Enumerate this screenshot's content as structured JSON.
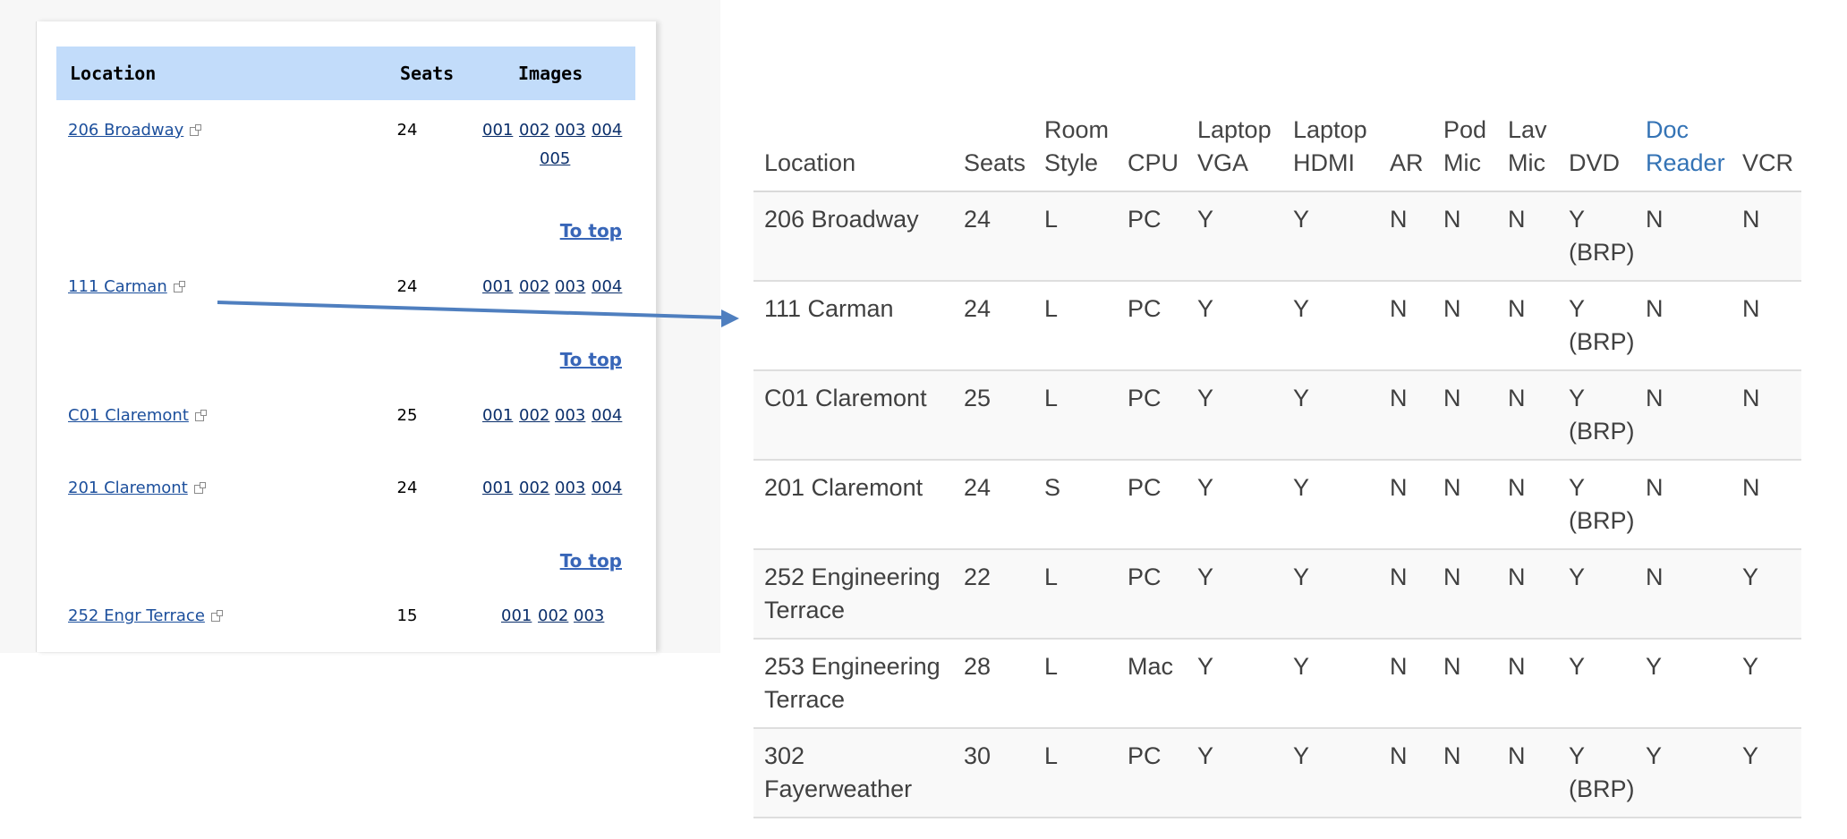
{
  "old_table": {
    "headers": {
      "location": "Location",
      "seats": "Seats",
      "images": "Images"
    },
    "to_top_label": "To top",
    "rows": [
      {
        "location": "206 Broadway",
        "seats": "24",
        "images": [
          "001",
          "002",
          "003",
          "004",
          "005"
        ]
      },
      {
        "location": "111 Carman",
        "seats": "24",
        "images": [
          "001",
          "002",
          "003",
          "004"
        ]
      },
      {
        "location": "C01 Claremont",
        "seats": "25",
        "images": [
          "001",
          "002",
          "003",
          "004"
        ]
      },
      {
        "location": "201 Claremont",
        "seats": "24",
        "images": [
          "001",
          "002",
          "003",
          "004"
        ]
      },
      {
        "location": "252 Engr Terrace",
        "seats": "15",
        "images": [
          "001",
          "002",
          "003"
        ]
      }
    ]
  },
  "new_table": {
    "headers": {
      "location": "Location",
      "seats": "Seats",
      "room_style": [
        "Room",
        "Style"
      ],
      "cpu": "CPU",
      "laptop_vga": [
        "Laptop",
        "VGA"
      ],
      "laptop_hdmi": [
        "Laptop",
        "HDMI"
      ],
      "ar": "AR",
      "pod_mic": [
        "Pod",
        "Mic"
      ],
      "lav_mic": [
        "Lav",
        "Mic"
      ],
      "dvd": "DVD",
      "doc_reader": [
        "Doc",
        "Reader"
      ],
      "vcr": "VCR"
    },
    "rows": [
      {
        "location": [
          "206 Broadway"
        ],
        "seats": "24",
        "room_style": "L",
        "cpu": "PC",
        "laptop_vga": "Y",
        "laptop_hdmi": "Y",
        "ar": "N",
        "pod_mic": "N",
        "lav_mic": "N",
        "dvd": [
          "Y",
          "(BRP)"
        ],
        "doc_reader": "N",
        "vcr": "N"
      },
      {
        "location": [
          "111 Carman"
        ],
        "seats": "24",
        "room_style": "L",
        "cpu": "PC",
        "laptop_vga": "Y",
        "laptop_hdmi": "Y",
        "ar": "N",
        "pod_mic": "N",
        "lav_mic": "N",
        "dvd": [
          "Y",
          "(BRP)"
        ],
        "doc_reader": "N",
        "vcr": "N"
      },
      {
        "location": [
          "C01 Claremont"
        ],
        "seats": "25",
        "room_style": "L",
        "cpu": "PC",
        "laptop_vga": "Y",
        "laptop_hdmi": "Y",
        "ar": "N",
        "pod_mic": "N",
        "lav_mic": "N",
        "dvd": [
          "Y",
          "(BRP)"
        ],
        "doc_reader": "N",
        "vcr": "N"
      },
      {
        "location": [
          "201 Claremont"
        ],
        "seats": "24",
        "room_style": "S",
        "cpu": "PC",
        "laptop_vga": "Y",
        "laptop_hdmi": "Y",
        "ar": "N",
        "pod_mic": "N",
        "lav_mic": "N",
        "dvd": [
          "Y",
          "(BRP)"
        ],
        "doc_reader": "N",
        "vcr": "N"
      },
      {
        "location": [
          "252 Engineering",
          "Terrace"
        ],
        "seats": "22",
        "room_style": "L",
        "cpu": "PC",
        "laptop_vga": "Y",
        "laptop_hdmi": "Y",
        "ar": "N",
        "pod_mic": "N",
        "lav_mic": "N",
        "dvd": [
          "Y"
        ],
        "doc_reader": "N",
        "vcr": "Y"
      },
      {
        "location": [
          "253 Engineering",
          "Terrace"
        ],
        "seats": "28",
        "room_style": "L",
        "cpu": "Mac",
        "laptop_vga": "Y",
        "laptop_hdmi": "Y",
        "ar": "N",
        "pod_mic": "N",
        "lav_mic": "N",
        "dvd": [
          "Y"
        ],
        "doc_reader": "Y",
        "vcr": "Y"
      },
      {
        "location": [
          "302",
          "Fayerweather"
        ],
        "seats": "30",
        "room_style": "L",
        "cpu": "PC",
        "laptop_vga": "Y",
        "laptop_hdmi": "Y",
        "ar": "N",
        "pod_mic": "N",
        "lav_mic": "N",
        "dvd": [
          "Y",
          "(BRP)"
        ],
        "doc_reader": "Y",
        "vcr": "Y"
      }
    ]
  },
  "colors": {
    "old_header_bg": "#c2dcfa",
    "old_link": "#1c4f9c",
    "to_top": "#3866b8",
    "arrow": "#4f7fbf",
    "new_header_link": "#3473b5",
    "new_row_stripe": "#f9f9f9"
  }
}
